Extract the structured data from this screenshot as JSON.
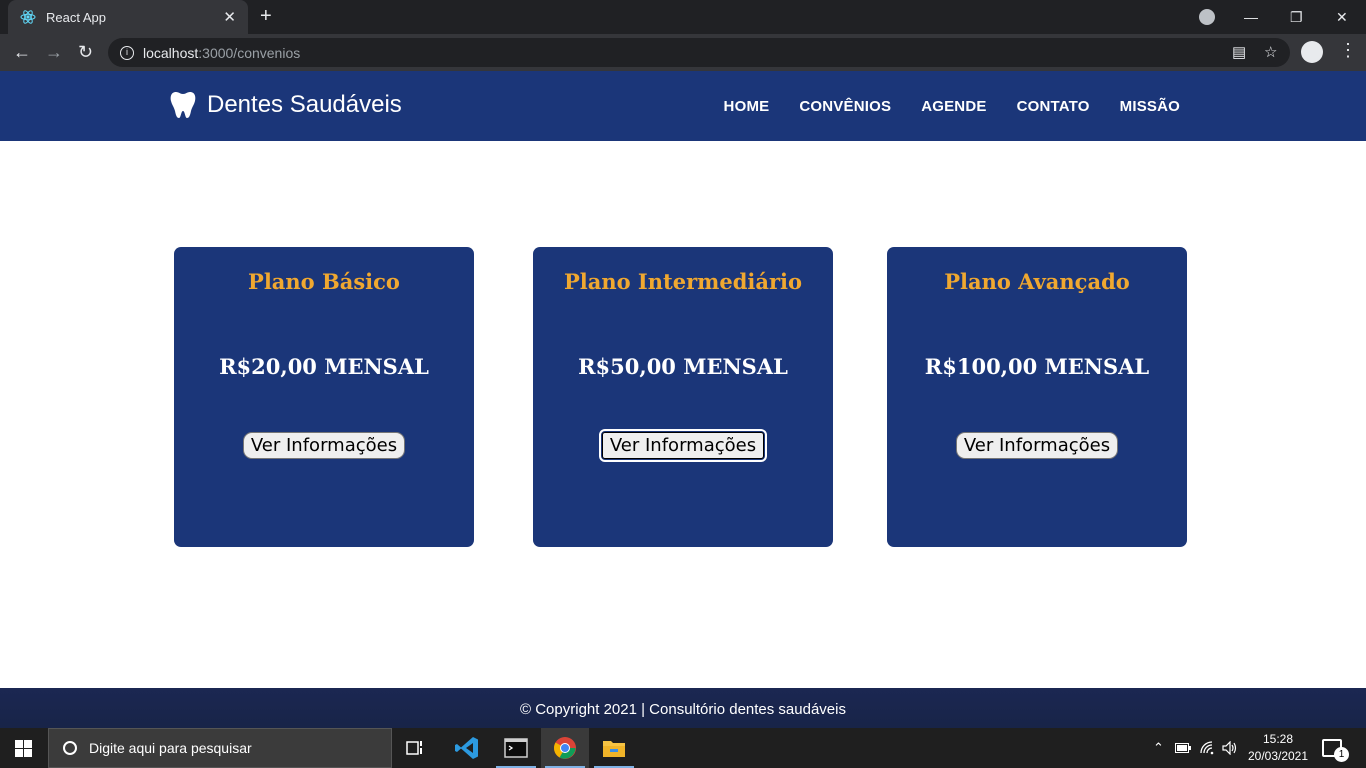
{
  "browser": {
    "tab_title": "React App",
    "tab_close": "✕",
    "new_tab": "+",
    "url_host": "localhost",
    "url_path": ":3000/convenios",
    "window_minimize": "—",
    "window_restore": "❐",
    "window_close": "✕"
  },
  "site": {
    "brand": "Dentes Saudáveis",
    "nav": [
      "HOME",
      "CONVÊNIOS",
      "AGENDE",
      "CONTATO",
      "MISSÃO"
    ]
  },
  "plans": [
    {
      "title": "Plano Básico",
      "price": "R$20,00 MENSAL",
      "button": "Ver Informações"
    },
    {
      "title": "Plano Intermediário",
      "price": "R$50,00 MENSAL",
      "button": "Ver Informações"
    },
    {
      "title": "Plano Avançado",
      "price": "R$100,00 MENSAL",
      "button": "Ver Informações"
    }
  ],
  "footer": {
    "text": "© Copyright 2021 | Consultório dentes saudáveis"
  },
  "taskbar": {
    "search_placeholder": "Digite aqui para pesquisar",
    "time": "15:28",
    "date": "20/03/2021",
    "notifications": "1"
  },
  "colors": {
    "navy": "#1b3679",
    "gold": "#f0a830",
    "footer": "#1b2752"
  }
}
